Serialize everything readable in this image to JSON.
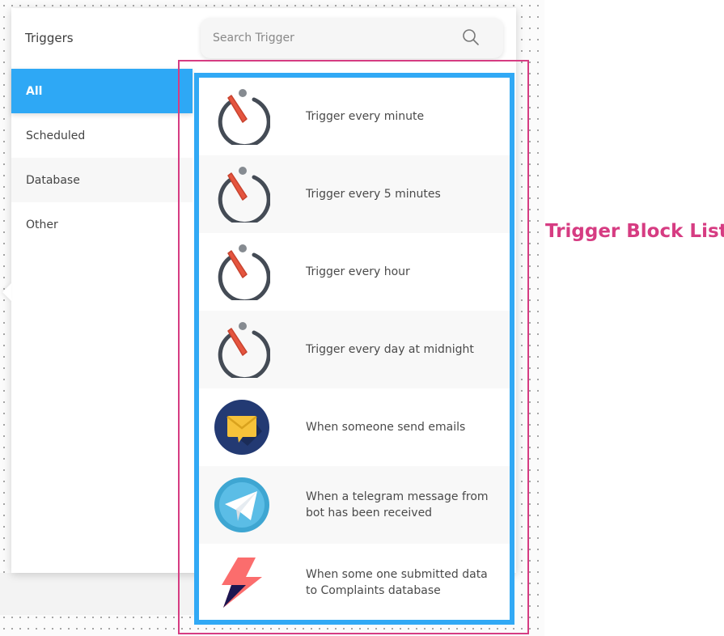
{
  "panel": {
    "title": "Triggers",
    "search": {
      "placeholder": "Search Trigger"
    }
  },
  "nav": [
    {
      "label": "All",
      "active": true
    },
    {
      "label": "Scheduled",
      "active": false
    },
    {
      "label": "Database",
      "active": false
    },
    {
      "label": "Other",
      "active": false
    }
  ],
  "triggers": [
    {
      "label": "Trigger every minute",
      "icon": "timer-icon"
    },
    {
      "label": "Trigger every 5 minutes",
      "icon": "timer-icon"
    },
    {
      "label": "Trigger every hour",
      "icon": "timer-icon"
    },
    {
      "label": "Trigger every day at midnight",
      "icon": "timer-icon"
    },
    {
      "label": "When someone send emails",
      "icon": "email-icon"
    },
    {
      "label": "When a telegram message from bot has been received",
      "icon": "telegram-icon"
    },
    {
      "label": "When some one submitted data to Complaints database",
      "icon": "lightning-icon"
    }
  ],
  "annotation": {
    "label": "Trigger Block List"
  },
  "colors": {
    "accent": "#2ea8f5",
    "annotation": "#d63c82",
    "timer_hand": "#e5553f",
    "timer_ring": "#444b55"
  }
}
